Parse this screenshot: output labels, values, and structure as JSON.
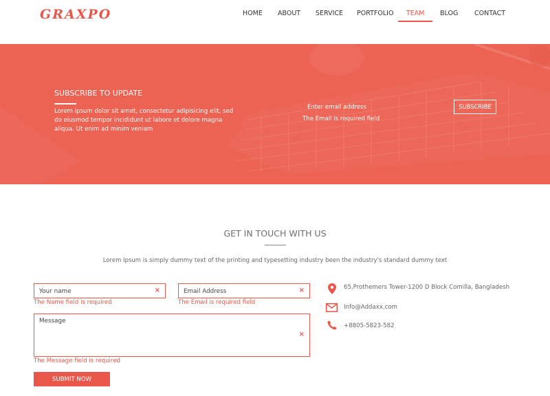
{
  "brand": {
    "logo": "GRAXPO",
    "accent": "#e8574a"
  },
  "nav": {
    "items": [
      {
        "label": "HOME",
        "active": false
      },
      {
        "label": "ABOUT",
        "active": false
      },
      {
        "label": "SERVICE",
        "active": false
      },
      {
        "label": "PORTFOLIO",
        "active": false
      },
      {
        "label": "TEAM",
        "active": true
      },
      {
        "label": "BLOG",
        "active": false
      },
      {
        "label": "CONTACT",
        "active": false
      }
    ]
  },
  "subscribe": {
    "title": "SUBSCRIBE TO UPDATE",
    "text": "Lorem ipsum dolor sit amet, consectetur adipisicing elit, sed do eiusmod tempor incididunt ut labore et dolore magna aliqua. Ut enim ad minim veniam",
    "email_placeholder": "Enter email address",
    "email_error": "The Email is required field",
    "button": "SUBSCRIBE",
    "band_color": "#ec6253"
  },
  "contact": {
    "title": "GET IN TOUCH WITH US",
    "subtitle": "Lorem Ipsum is simply dummy text of the printing and typesetting industry been the industry's standard dummy text",
    "name_placeholder": "Your name",
    "name_error": "The Name field is required",
    "email_placeholder": "Email Address",
    "email_error": "The Email is required field",
    "message_placeholder": "Message",
    "message_error": "The Message field is required",
    "clear_glyph": "×",
    "submit": "SUBMIT NOW",
    "info": {
      "address": "65,Prothemers Tower-1200 D Block Comilla, Bangladesh",
      "email": "Info@Addaxx.com",
      "phone": "+8805-5823-582"
    },
    "icons": [
      "map-pin-icon",
      "envelope-icon",
      "phone-icon"
    ]
  }
}
